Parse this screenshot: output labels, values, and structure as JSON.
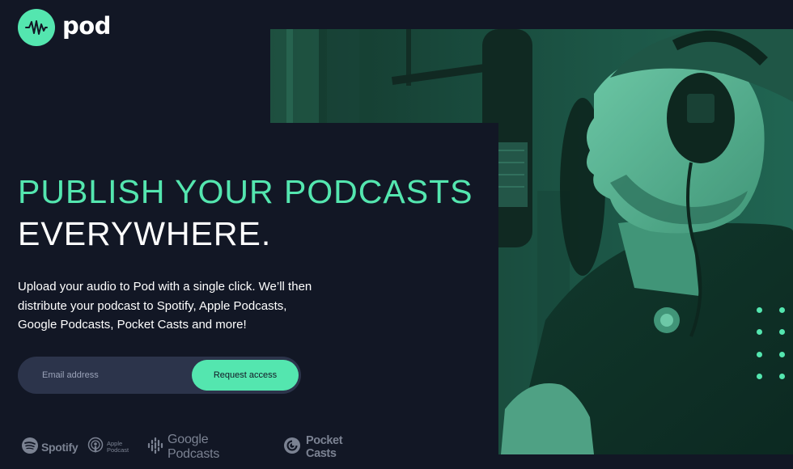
{
  "brand": {
    "name": "pod",
    "accent_color": "#54e6af",
    "background_color": "#121725",
    "logo_icon": "soundwave-icon"
  },
  "hero": {
    "headline_line1": "PUBLISH YOUR PODCASTS",
    "headline_line2": "EVERYWHERE.",
    "description": "Upload your audio to Pod with a single click. We’ll then distribute your podcast to Spotify, Apple Podcasts, Google Podcasts, Pocket Casts and more!",
    "image_icon": "podcaster-photo"
  },
  "signup": {
    "email_placeholder": "Email address",
    "email_value": "",
    "button_label": "Request access",
    "field_background": "#2c344b"
  },
  "partners": {
    "color": "#7b8292",
    "spotify": {
      "label": "Spotify",
      "icon": "spotify-icon"
    },
    "apple": {
      "label": "Apple Podcast",
      "icon": "apple-podcasts-icon"
    },
    "google": {
      "label": "Google Podcasts",
      "icon": "google-podcasts-icon"
    },
    "pocket": {
      "label": "Pocket Casts",
      "icon": "pocket-casts-icon"
    }
  }
}
